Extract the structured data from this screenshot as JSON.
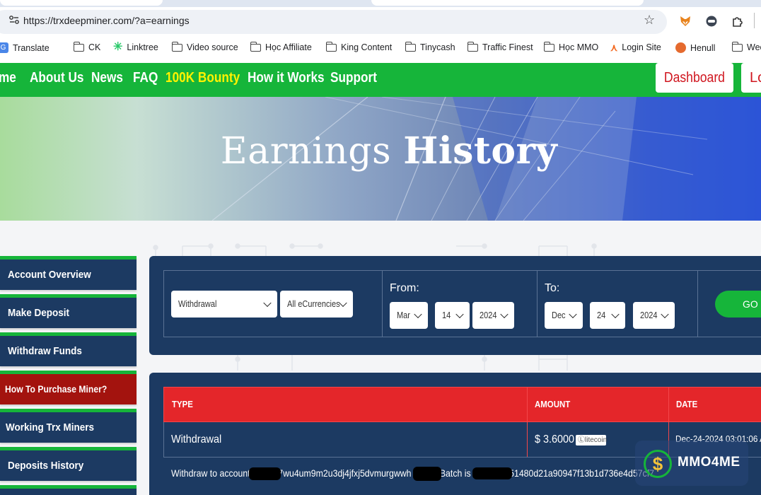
{
  "browser": {
    "url": "https://trxdeepminer.com/?a=earnings",
    "bookmarks": [
      "Translate",
      "CK",
      "Linktree",
      "Video source",
      "Học Affiliate",
      "King Content",
      "Tinycash",
      "Traffic Finest",
      "Học MMO",
      "Login Site",
      "Henull",
      "Wee"
    ]
  },
  "nav": {
    "items": [
      "me",
      "About Us",
      "News",
      "FAQ",
      "100K Bounty",
      "How it Works",
      "Support"
    ],
    "dashboard": "Dashboard",
    "login": "Lo"
  },
  "hero": {
    "title_light": "Earnings",
    "title_bold": "History"
  },
  "sidebar": {
    "items": [
      "Account Overview",
      "Make Deposit",
      "Withdraw Funds",
      "How To Purchase Miner?",
      "Working Trx Miners",
      "Deposits History"
    ]
  },
  "filter": {
    "type": "Withdrawal",
    "currency": "All eCurrencies",
    "from_label": "From:",
    "from": {
      "month": "Mar",
      "day": "14",
      "year": "2024"
    },
    "to_label": "To:",
    "to": {
      "month": "Dec",
      "day": "24",
      "year": "2024"
    },
    "go": "GO"
  },
  "table": {
    "headers": [
      "TYPE",
      "AMOUNT",
      "DATE"
    ],
    "rows": [
      {
        "type": "Withdrawal",
        "amount": "$ 3.6000",
        "currency_badge": "litecoin",
        "date": "Dec-24-2024 03:01:06 A",
        "detail_prefix": "Withdraw to account l",
        "detail_account": "7wu4um9m2u3dj4jfxj5dvmurgwwh",
        "detail_mid": ". Batch is ",
        "detail_batch": "51480d21a90947f13b1d736e4d57cf7"
      }
    ]
  },
  "watermark": "MMO4ME",
  "colors": {
    "nav_green": "#16b53a",
    "panel_navy": "#1c3a62",
    "header_red": "#e4262a",
    "bounty_yellow": "#fff200"
  }
}
